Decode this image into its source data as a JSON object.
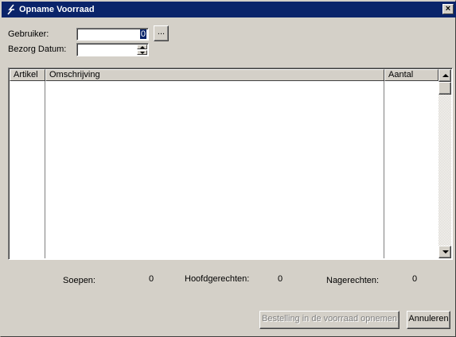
{
  "window": {
    "title": "Opname Voorraad",
    "icon": "app-arrow-icon",
    "close_label": "×"
  },
  "form": {
    "gebruiker_label": "Gebruiker:",
    "gebruiker_value": "0",
    "browse_label": "...",
    "bezorg_datum_label": "Bezorg Datum:",
    "bezorg_datum_value": ""
  },
  "grid": {
    "columns": [
      "Artikel",
      "Omschrijving",
      "Aantal"
    ],
    "rows": []
  },
  "totals": {
    "soepen_label": "Soepen:",
    "soepen_value": "0",
    "hoofdgerechten_label": "Hoofdgerechten:",
    "hoofdgerechten_value": "0",
    "nagerechten_label": "Nagerechten:",
    "nagerechten_value": "0"
  },
  "buttons": {
    "bestelling_label": "Bestelling in de voorraad opnemen",
    "annuleren_label": "Annuleren"
  },
  "colors": {
    "titlebar": "#0a246a",
    "face": "#d4d0c8",
    "selection": "#0a246a"
  }
}
